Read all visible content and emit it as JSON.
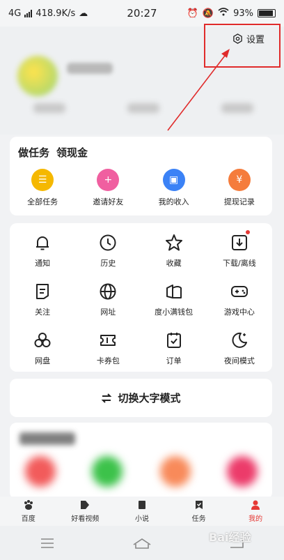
{
  "status_bar": {
    "network": "4G",
    "speed": "418.9K/s",
    "time": "20:27",
    "battery": "93%"
  },
  "header": {
    "settings_label": "设置"
  },
  "tasks": {
    "title": "做任务",
    "subtitle": "领现金",
    "items": [
      {
        "label": "全部任务",
        "icon": "task-list-icon",
        "color": "#f5b800"
      },
      {
        "label": "邀请好友",
        "icon": "invite-friend-icon",
        "color": "#f05fa0"
      },
      {
        "label": "我的收入",
        "icon": "wallet-icon",
        "color": "#3b82f6"
      },
      {
        "label": "提现记录",
        "icon": "withdraw-icon",
        "color": "#f57c3c"
      }
    ]
  },
  "tools": {
    "items": [
      {
        "label": "通知",
        "icon": "bell-icon"
      },
      {
        "label": "历史",
        "icon": "clock-icon"
      },
      {
        "label": "收藏",
        "icon": "star-icon"
      },
      {
        "label": "下载/离线",
        "icon": "download-icon"
      },
      {
        "label": "关注",
        "icon": "follow-icon"
      },
      {
        "label": "网址",
        "icon": "globe-icon"
      },
      {
        "label": "度小满钱包",
        "icon": "purse-icon"
      },
      {
        "label": "游戏中心",
        "icon": "gamepad-icon"
      },
      {
        "label": "网盘",
        "icon": "cloud-disk-icon"
      },
      {
        "label": "卡券包",
        "icon": "ticket-icon"
      },
      {
        "label": "订单",
        "icon": "order-icon"
      },
      {
        "label": "夜间模式",
        "icon": "moon-icon"
      }
    ]
  },
  "big_font": {
    "label": "切换大字模式"
  },
  "tabbar": {
    "items": [
      {
        "label": "百度",
        "active": false
      },
      {
        "label": "好看视频",
        "active": false
      },
      {
        "label": "小说",
        "active": false
      },
      {
        "label": "任务",
        "active": false
      },
      {
        "label": "我的",
        "active": true
      }
    ]
  },
  "watermark": "Bai经验"
}
